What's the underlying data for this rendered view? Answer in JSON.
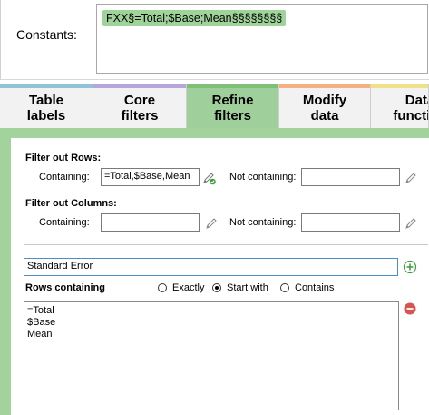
{
  "constants": {
    "label": "Constants:",
    "value": "FXX§=Total;$Base;Mean§§§§§§§§"
  },
  "tabs": [
    {
      "line1": "Table",
      "line2": "labels",
      "color": "#8fc3d6"
    },
    {
      "line1": "Core",
      "line2": "filters",
      "color": "#b6a6d9"
    },
    {
      "line1": "Refine",
      "line2": "filters",
      "color": "#7fbf78",
      "active": true
    },
    {
      "line1": "Modify",
      "line2": "data",
      "color": "#f4b083"
    },
    {
      "line1": "Data",
      "line2": "function",
      "color": "#efe08a"
    }
  ],
  "refine": {
    "filter_rows": {
      "title": "Filter out Rows:",
      "containing_label": "Containing:",
      "containing_value": "=Total,$Base,Mean",
      "not_containing_label": "Not containing:",
      "not_containing_value": ""
    },
    "filter_columns": {
      "title": "Filter out Columns:",
      "containing_label": "Containing:",
      "containing_value": "",
      "not_containing_label": "Not containing:",
      "not_containing_value": ""
    },
    "rule_name": "Standard Error",
    "rows_containing_label": "Rows containing",
    "match_options": {
      "exactly": "Exactly",
      "start_with": "Start with",
      "contains": "Contains",
      "selected": "start_with"
    },
    "rows_list": [
      "=Total",
      "$Base",
      "Mean"
    ]
  },
  "colors": {
    "accent_green": "#a3d39c",
    "highlight_green": "#9fd39a",
    "add_icon": "#3c9e3c",
    "remove_icon": "#d9534f"
  }
}
